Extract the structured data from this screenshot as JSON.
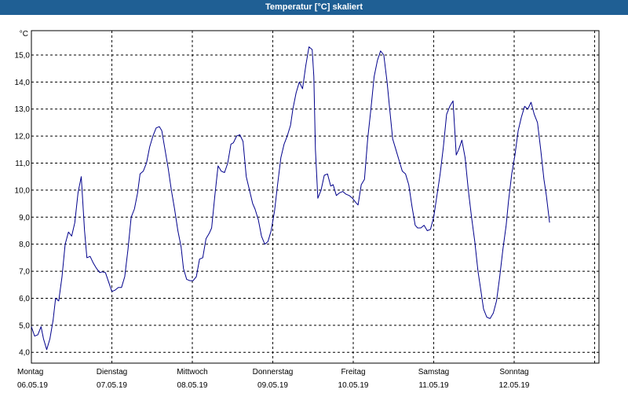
{
  "title": "Temperatur [°C] skaliert",
  "chart_data": {
    "type": "line",
    "title": "Temperatur [°C] skaliert",
    "ylabel": "°C",
    "xlabel": "",
    "ylim": [
      3.6,
      15.9
    ],
    "grid": true,
    "y_ticks": [
      "4,0",
      "5,0",
      "6,0",
      "7,0",
      "8,0",
      "9,0",
      "10,0",
      "11,0",
      "12,0",
      "13,0",
      "14,0",
      "15,0"
    ],
    "y_tick_values": [
      4,
      5,
      6,
      7,
      8,
      9,
      10,
      11,
      12,
      13,
      14,
      15
    ],
    "x_range": [
      0,
      7
    ],
    "x_ticks": [
      {
        "day": "Montag",
        "date": "06.05.19",
        "x": 0
      },
      {
        "day": "Dienstag",
        "date": "07.05.19",
        "x": 1
      },
      {
        "day": "Mittwoch",
        "date": "08.05.19",
        "x": 2
      },
      {
        "day": "Donnerstag",
        "date": "09.05.19",
        "x": 3
      },
      {
        "day": "Freitag",
        "date": "10.05.19",
        "x": 4
      },
      {
        "day": "Samstag",
        "date": "11.05.19",
        "x": 5
      },
      {
        "day": "Sonntag",
        "date": "12.05.19",
        "x": 6
      }
    ],
    "series": [
      {
        "color": "#00008b",
        "points": [
          [
            0.0,
            4.95
          ],
          [
            0.04,
            4.6
          ],
          [
            0.08,
            4.65
          ],
          [
            0.12,
            4.95
          ],
          [
            0.15,
            4.5
          ],
          [
            0.19,
            4.1
          ],
          [
            0.23,
            4.5
          ],
          [
            0.27,
            5.2
          ],
          [
            0.3,
            6.0
          ],
          [
            0.34,
            5.9
          ],
          [
            0.38,
            6.8
          ],
          [
            0.42,
            8.0
          ],
          [
            0.46,
            8.45
          ],
          [
            0.5,
            8.3
          ],
          [
            0.54,
            8.8
          ],
          [
            0.58,
            9.9
          ],
          [
            0.62,
            10.5
          ],
          [
            0.66,
            8.5
          ],
          [
            0.69,
            7.5
          ],
          [
            0.73,
            7.55
          ],
          [
            0.77,
            7.3
          ],
          [
            0.81,
            7.1
          ],
          [
            0.85,
            6.95
          ],
          [
            0.88,
            6.98
          ],
          [
            0.92,
            6.95
          ],
          [
            0.96,
            6.6
          ],
          [
            1.0,
            6.25
          ],
          [
            1.04,
            6.3
          ],
          [
            1.08,
            6.4
          ],
          [
            1.12,
            6.4
          ],
          [
            1.16,
            6.8
          ],
          [
            1.2,
            7.8
          ],
          [
            1.24,
            9.0
          ],
          [
            1.28,
            9.3
          ],
          [
            1.32,
            9.9
          ],
          [
            1.35,
            10.6
          ],
          [
            1.39,
            10.7
          ],
          [
            1.43,
            11.0
          ],
          [
            1.47,
            11.6
          ],
          [
            1.51,
            12.0
          ],
          [
            1.55,
            12.3
          ],
          [
            1.59,
            12.35
          ],
          [
            1.62,
            12.2
          ],
          [
            1.66,
            11.5
          ],
          [
            1.7,
            10.8
          ],
          [
            1.74,
            10.0
          ],
          [
            1.78,
            9.3
          ],
          [
            1.82,
            8.5
          ],
          [
            1.86,
            7.9
          ],
          [
            1.89,
            7.1
          ],
          [
            1.93,
            6.7
          ],
          [
            1.97,
            6.65
          ],
          [
            2.01,
            6.65
          ],
          [
            2.05,
            6.8
          ],
          [
            2.09,
            7.45
          ],
          [
            2.13,
            7.5
          ],
          [
            2.17,
            8.2
          ],
          [
            2.21,
            8.4
          ],
          [
            2.24,
            8.6
          ],
          [
            2.28,
            9.8
          ],
          [
            2.32,
            10.9
          ],
          [
            2.36,
            10.7
          ],
          [
            2.4,
            10.65
          ],
          [
            2.44,
            11.0
          ],
          [
            2.48,
            11.7
          ],
          [
            2.51,
            11.75
          ],
          [
            2.55,
            12.0
          ],
          [
            2.59,
            12.05
          ],
          [
            2.63,
            11.8
          ],
          [
            2.67,
            10.5
          ],
          [
            2.71,
            10.0
          ],
          [
            2.75,
            9.5
          ],
          [
            2.78,
            9.3
          ],
          [
            2.82,
            8.9
          ],
          [
            2.86,
            8.3
          ],
          [
            2.9,
            8.0
          ],
          [
            2.94,
            8.1
          ],
          [
            2.98,
            8.5
          ],
          [
            3.02,
            9.2
          ],
          [
            3.06,
            10.2
          ],
          [
            3.1,
            11.2
          ],
          [
            3.14,
            11.7
          ],
          [
            3.18,
            12.0
          ],
          [
            3.22,
            12.4
          ],
          [
            3.25,
            13.0
          ],
          [
            3.29,
            13.6
          ],
          [
            3.33,
            14.0
          ],
          [
            3.37,
            13.75
          ],
          [
            3.41,
            14.6
          ],
          [
            3.45,
            15.3
          ],
          [
            3.49,
            15.2
          ],
          [
            3.51,
            14.2
          ],
          [
            3.53,
            11.5
          ],
          [
            3.56,
            9.7
          ],
          [
            3.6,
            10.0
          ],
          [
            3.64,
            10.55
          ],
          [
            3.68,
            10.6
          ],
          [
            3.72,
            10.15
          ],
          [
            3.75,
            10.2
          ],
          [
            3.79,
            9.8
          ],
          [
            3.83,
            9.9
          ],
          [
            3.87,
            9.95
          ],
          [
            3.91,
            9.85
          ],
          [
            3.95,
            9.8
          ],
          [
            3.99,
            9.7
          ],
          [
            4.03,
            9.55
          ],
          [
            4.06,
            9.45
          ],
          [
            4.1,
            10.2
          ],
          [
            4.14,
            10.4
          ],
          [
            4.18,
            11.9
          ],
          [
            4.22,
            13.0
          ],
          [
            4.26,
            14.2
          ],
          [
            4.3,
            14.8
          ],
          [
            4.34,
            15.15
          ],
          [
            4.38,
            15.0
          ],
          [
            4.42,
            14.0
          ],
          [
            4.46,
            12.8
          ],
          [
            4.49,
            11.9
          ],
          [
            4.53,
            11.5
          ],
          [
            4.57,
            11.1
          ],
          [
            4.61,
            10.7
          ],
          [
            4.65,
            10.6
          ],
          [
            4.69,
            10.2
          ],
          [
            4.73,
            9.4
          ],
          [
            4.77,
            8.7
          ],
          [
            4.8,
            8.6
          ],
          [
            4.84,
            8.6
          ],
          [
            4.88,
            8.7
          ],
          [
            4.92,
            8.5
          ],
          [
            4.96,
            8.55
          ],
          [
            5.0,
            9.0
          ],
          [
            5.04,
            9.8
          ],
          [
            5.08,
            10.6
          ],
          [
            5.12,
            11.6
          ],
          [
            5.16,
            12.8
          ],
          [
            5.2,
            13.1
          ],
          [
            5.24,
            13.3
          ],
          [
            5.28,
            11.3
          ],
          [
            5.31,
            11.5
          ],
          [
            5.35,
            11.85
          ],
          [
            5.39,
            11.2
          ],
          [
            5.43,
            10.0
          ],
          [
            5.47,
            9.0
          ],
          [
            5.51,
            8.1
          ],
          [
            5.55,
            7.0
          ],
          [
            5.59,
            6.2
          ],
          [
            5.62,
            5.6
          ],
          [
            5.66,
            5.3
          ],
          [
            5.7,
            5.25
          ],
          [
            5.74,
            5.45
          ],
          [
            5.78,
            5.9
          ],
          [
            5.82,
            6.8
          ],
          [
            5.86,
            7.8
          ],
          [
            5.9,
            8.7
          ],
          [
            5.93,
            9.6
          ],
          [
            5.97,
            10.6
          ],
          [
            6.01,
            11.3
          ],
          [
            6.05,
            12.2
          ],
          [
            6.09,
            12.7
          ],
          [
            6.13,
            13.1
          ],
          [
            6.17,
            13.0
          ],
          [
            6.21,
            13.25
          ],
          [
            6.25,
            12.8
          ],
          [
            6.29,
            12.5
          ],
          [
            6.33,
            11.5
          ],
          [
            6.37,
            10.4
          ],
          [
            6.4,
            9.8
          ],
          [
            6.44,
            8.8
          ]
        ]
      }
    ]
  }
}
